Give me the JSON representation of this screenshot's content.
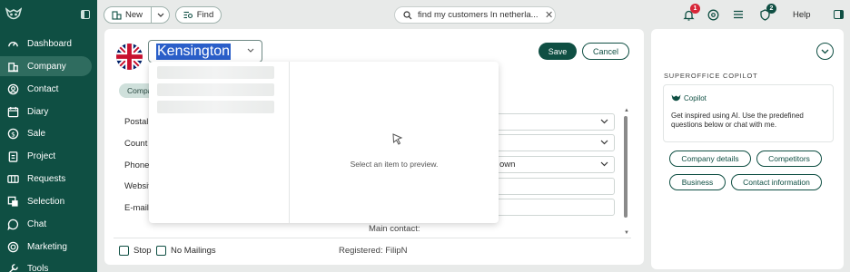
{
  "sidebar": {
    "logo": "superoffice-owl-logo",
    "collapse_icon": "sidebar-collapse-icon",
    "items": [
      {
        "label": "Dashboard",
        "icon": "dashboard-icon"
      },
      {
        "label": "Company",
        "icon": "company-icon",
        "active": true
      },
      {
        "label": "Contact",
        "icon": "contact-icon"
      },
      {
        "label": "Diary",
        "icon": "diary-icon"
      },
      {
        "label": "Sale",
        "icon": "sale-icon"
      },
      {
        "label": "Project",
        "icon": "project-icon"
      },
      {
        "label": "Requests",
        "icon": "requests-icon"
      },
      {
        "label": "Selection",
        "icon": "selection-icon"
      },
      {
        "label": "Chat",
        "icon": "chat-icon"
      },
      {
        "label": "Marketing",
        "icon": "marketing-icon"
      },
      {
        "label": "Tools",
        "icon": "tools-icon"
      }
    ]
  },
  "topbar": {
    "new_label": "New",
    "find_label": "Find",
    "search_query": "find my customers In netherla...",
    "notifications_badge": "1",
    "chat_badge": "2",
    "help_label": "Help"
  },
  "company": {
    "name": "Kensington",
    "save_label": "Save",
    "cancel_label": "Cancel",
    "tab_label": "Company"
  },
  "fields": {
    "postal_label": "Postal",
    "country_label": "Count",
    "phone_label": "Phone",
    "website_label": "Websit",
    "email_label": "E-mail",
    "phone_value": "own",
    "main_contact_label": "Main contact:",
    "stop_label": "Stop",
    "no_mailings_label": "No Mailings",
    "registered_label": "Registered: FilipN"
  },
  "dropdown": {
    "preview_text": "Select an item to preview."
  },
  "copilot": {
    "title": "SUPEROFFICE COPILOT",
    "brand": "Copilot",
    "intro": "Get inspired using AI. Use the predefined questions below or chat with me.",
    "chips": [
      "Company details",
      "Competitors",
      "Business",
      "Contact information"
    ]
  },
  "colors": {
    "brand_dark": "#0f4f43",
    "selection_blue": "#2a5fc9",
    "badge_red": "#d72638"
  }
}
